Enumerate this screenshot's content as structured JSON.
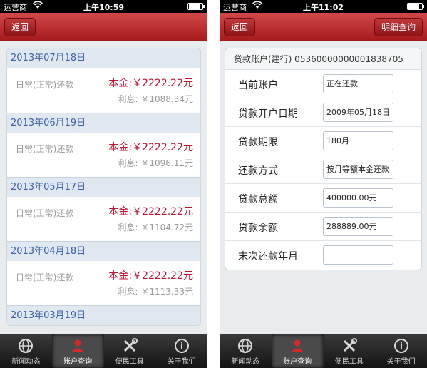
{
  "left": {
    "status": {
      "carrier": "运营商",
      "time": "上午10:59",
      "battery_level": 0.85
    },
    "nav": {
      "back_label": "返回"
    },
    "records": [
      {
        "date": "2013年07月18日",
        "type": "日常(正常)还款",
        "principal": "本金:￥2222.22元",
        "interest": "利息: ￥1088.34元"
      },
      {
        "date": "2013年06月19日",
        "type": "日常(正常)还款",
        "principal": "本金:￥2222.22元",
        "interest": "利息: ￥1096.11元"
      },
      {
        "date": "2013年05月17日",
        "type": "日常(正常)还款",
        "principal": "本金:￥2222.22元",
        "interest": "利息: ￥1104.72元"
      },
      {
        "date": "2013年04月18日",
        "type": "日常(正常)还款",
        "principal": "本金:￥2222.22元",
        "interest": "利息: ￥1113.33元"
      },
      {
        "date": "2013年03月19日"
      }
    ],
    "tabs": [
      {
        "label": "新闻动态",
        "icon": "globe-icon"
      },
      {
        "label": "账户查询",
        "icon": "user-icon",
        "active": true
      },
      {
        "label": "便民工具",
        "icon": "tools-icon"
      },
      {
        "label": "关于我们",
        "icon": "info-icon"
      }
    ]
  },
  "right": {
    "status": {
      "carrier": "运营商",
      "time": "上午11:02",
      "battery_level": 0.85
    },
    "nav": {
      "back_label": "返回",
      "detail_label": "明细查询"
    },
    "account_line": "贷款账户(建行) 05360000000001838705",
    "fields": [
      {
        "label": "当前账户",
        "value": "正在还款"
      },
      {
        "label": "贷款开户日期",
        "value": "2009年05月18日"
      },
      {
        "label": "贷款期限",
        "value": "180月"
      },
      {
        "label": "还款方式",
        "value": "按月等额本金还款"
      },
      {
        "label": "贷款总额",
        "value": "400000.00元"
      },
      {
        "label": "贷款余额",
        "value": "288889.00元"
      },
      {
        "label": "末次还款年月",
        "value": ""
      }
    ],
    "tabs": [
      {
        "label": "新闻动态",
        "icon": "globe-icon"
      },
      {
        "label": "账户查询",
        "icon": "user-icon",
        "active": true
      },
      {
        "label": "便民工具",
        "icon": "tools-icon"
      },
      {
        "label": "关于我们",
        "icon": "info-icon"
      }
    ]
  },
  "colors": {
    "nav_red": "#b82427",
    "principal_red": "#c8102e",
    "date_blue": "#3c63a8"
  }
}
